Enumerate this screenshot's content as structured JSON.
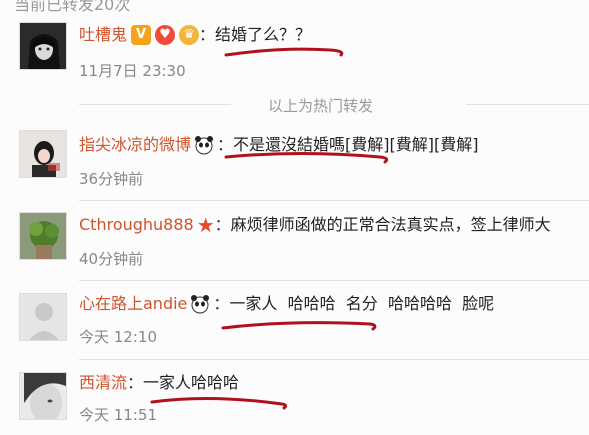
{
  "header": {
    "cut_text": "当前已转发20次"
  },
  "divider": {
    "label": "以上为热门转发"
  },
  "comments": [
    {
      "username": "吐槽鬼",
      "text": "结婚了么？？",
      "time": "11月7日 23:30"
    },
    {
      "username": "指尖冰凉的微博",
      "text": "不是還沒結婚嗎[費解][費解][費解]",
      "time": "36分钟前"
    },
    {
      "username": "Cthroughu888",
      "text": "麻烦律师函做的正常合法真实点，签上律师大",
      "time": "40分钟前"
    },
    {
      "username": "心在路上andie",
      "text": "一家人  哈哈哈  名分  哈哈哈哈  脸呢",
      "time": "今天 12:10"
    },
    {
      "username": "西清流",
      "text": "一家人哈哈哈",
      "time": "今天 11:51"
    }
  ],
  "colors": {
    "username": "#d0542c",
    "scribble": "#b0121d",
    "separator": "#e2e2e2"
  },
  "icons": [
    "v-badge-icon",
    "heart-badge-icon",
    "crown-badge-icon",
    "panda-emoji-icon",
    "star-icon"
  ]
}
